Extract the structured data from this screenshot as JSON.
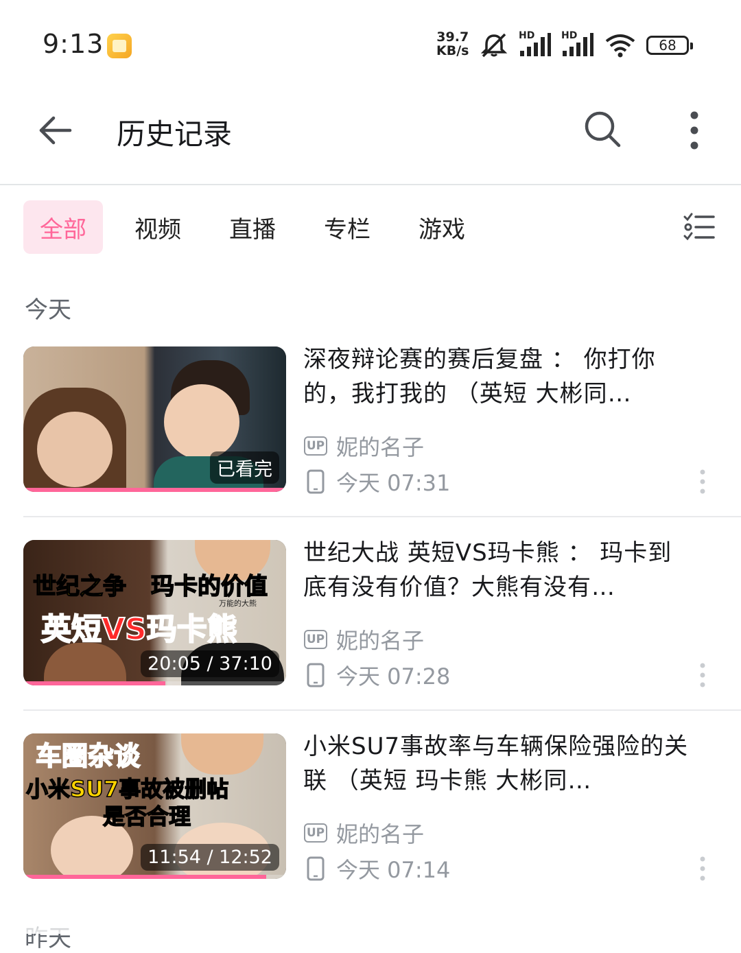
{
  "status_bar": {
    "time": "9:13",
    "net_speed_value": "39.7",
    "net_speed_unit": "KB/s",
    "battery": "68",
    "signal_label_1": "HD",
    "signal_label_2": "HD"
  },
  "header": {
    "title": "历史记录"
  },
  "tabs": [
    "全部",
    "视频",
    "直播",
    "专栏",
    "游戏"
  ],
  "active_tab": "全部",
  "section_today": "今天",
  "section_next": "昨天",
  "colors": {
    "accent": "#ff6699",
    "tab_active_bg": "#fde6ee",
    "meta": "#9499a0"
  },
  "items": [
    {
      "title": "深夜辩论赛的赛后复盘 ： 你打你的，我打我的 （英短 大彬同…",
      "author": "妮的名子",
      "time": "今天 07:31",
      "badge": "已看完",
      "progress": 1.0,
      "thumb_text": []
    },
    {
      "title": "世纪大战 英短VS玛卡熊 ： 玛卡到底有没有价值？大熊有没有…",
      "author": "妮的名子",
      "time": "今天 07:28",
      "badge": "20:05 / 37:10",
      "progress": 0.54,
      "thumb_text": [
        "世纪之争",
        "玛卡的价值",
        "英短VS玛卡熊",
        "万能的大熊"
      ]
    },
    {
      "title": "小米SU7事故率与车辆保险强险的关联 （英短 玛卡熊 大彬同…",
      "author": "妮的名子",
      "time": "今天 07:14",
      "badge": "11:54 / 12:52",
      "progress": 0.925,
      "thumb_text": [
        "车圈杂谈",
        "小米SU7事故被删帖",
        "是否合理"
      ]
    }
  ],
  "up_label": "UP"
}
